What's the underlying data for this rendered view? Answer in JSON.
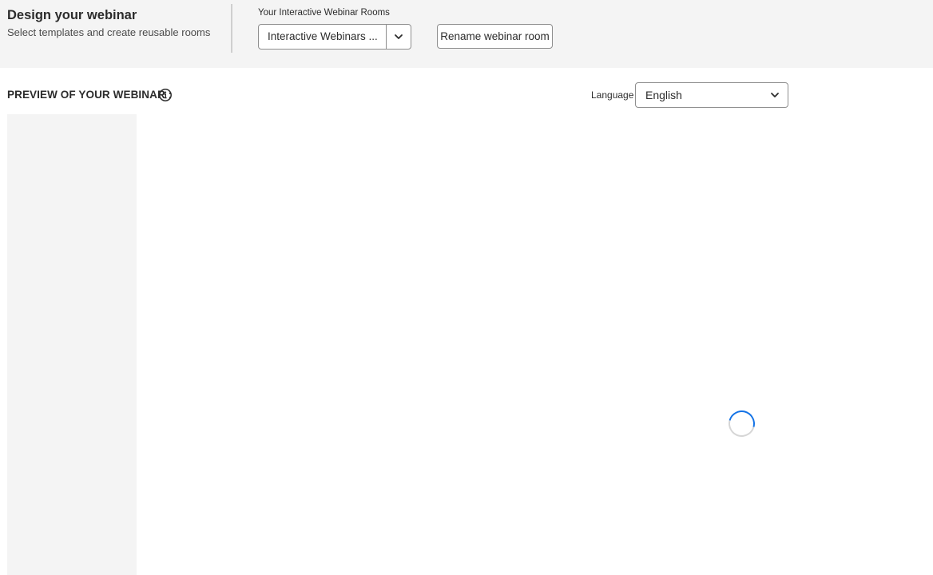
{
  "header": {
    "title": "Design your webinar",
    "subtitle": "Select templates and create reusable rooms"
  },
  "rooms": {
    "label": "Your Interactive Webinar Rooms",
    "selected": "Interactive Webinars ...",
    "rename_label": "Rename webinar room"
  },
  "preview": {
    "heading": "PREVIEW OF YOUR WEBINAR :",
    "language_label": "Language",
    "language_value": "English"
  },
  "icons": {
    "info": "info-icon",
    "rooms_dropdown": "chevron-down-icon",
    "language_dropdown": "chevron-down-icon",
    "loading": "loading-spinner"
  },
  "colors": {
    "topbar_bg": "#f4f4f4",
    "sidebar_bg": "#f4f4f4",
    "spinner_accent": "#1473e6",
    "border": "#8e8e8e"
  }
}
